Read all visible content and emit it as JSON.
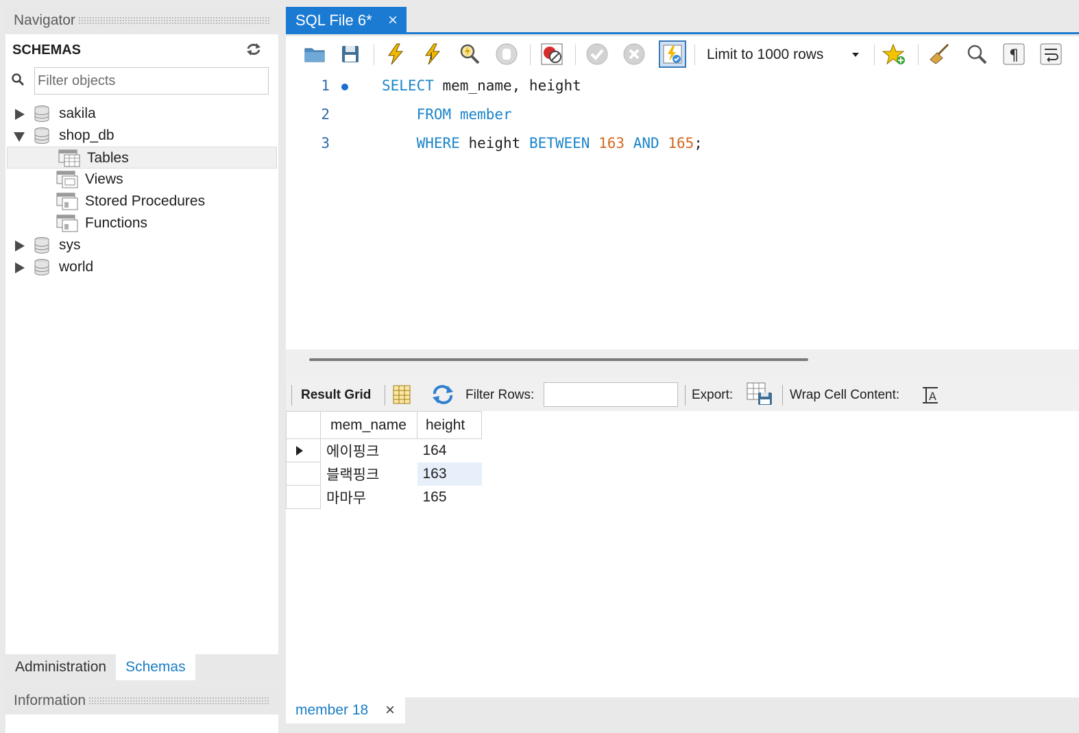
{
  "navigator": {
    "title": "Navigator",
    "schemas_title": "SCHEMAS",
    "filter_placeholder": "Filter objects",
    "schemas": [
      {
        "name": "sakila",
        "expanded": false
      },
      {
        "name": "shop_db",
        "expanded": true,
        "children": [
          "Tables",
          "Views",
          "Stored Procedures",
          "Functions"
        ]
      },
      {
        "name": "sys",
        "expanded": false
      },
      {
        "name": "world",
        "expanded": false
      }
    ],
    "selected_child": "Tables"
  },
  "bottom_tabs": {
    "administration": "Administration",
    "schemas": "Schemas",
    "active": "Schemas"
  },
  "information": {
    "title": "Information"
  },
  "editor": {
    "tab_title": "SQL File 6*",
    "tab_close": "×",
    "limit_label": "Limit to 1000 rows",
    "lines": [
      {
        "number": "1",
        "tokens": [
          {
            "t": "SELECT",
            "k": "kw"
          },
          {
            "t": " mem_name, height",
            "k": "plain"
          }
        ]
      },
      {
        "number": "2",
        "tokens": [
          {
            "t": "    ",
            "k": "plain"
          },
          {
            "t": "FROM",
            "k": "kw"
          },
          {
            "t": " ",
            "k": "plain"
          },
          {
            "t": "member",
            "k": "kw"
          }
        ]
      },
      {
        "number": "3",
        "tokens": [
          {
            "t": "    ",
            "k": "plain"
          },
          {
            "t": "WHERE",
            "k": "kw"
          },
          {
            "t": " height ",
            "k": "plain"
          },
          {
            "t": "BETWEEN",
            "k": "kw"
          },
          {
            "t": " ",
            "k": "plain"
          },
          {
            "t": "163",
            "k": "num"
          },
          {
            "t": " ",
            "k": "plain"
          },
          {
            "t": "AND",
            "k": "kw"
          },
          {
            "t": " ",
            "k": "plain"
          },
          {
            "t": "165",
            "k": "num"
          },
          {
            "t": ";",
            "k": "plain"
          }
        ]
      }
    ]
  },
  "result": {
    "result_grid_label": "Result Grid",
    "filter_rows_label": "Filter Rows:",
    "export_label": "Export:",
    "wrap_label": "Wrap Cell Content:",
    "columns": [
      "mem_name",
      "height"
    ],
    "rows": [
      [
        "에이핑크",
        "164"
      ],
      [
        "블랙핑크",
        "163"
      ],
      [
        "마마무",
        "165"
      ]
    ]
  },
  "output_tab": {
    "label": "member 18",
    "close": "×"
  },
  "colors": {
    "accent": "#1b7bd2",
    "keyword": "#1a84c9",
    "number": "#d2691e",
    "tab_text": "#1a7dc4"
  }
}
